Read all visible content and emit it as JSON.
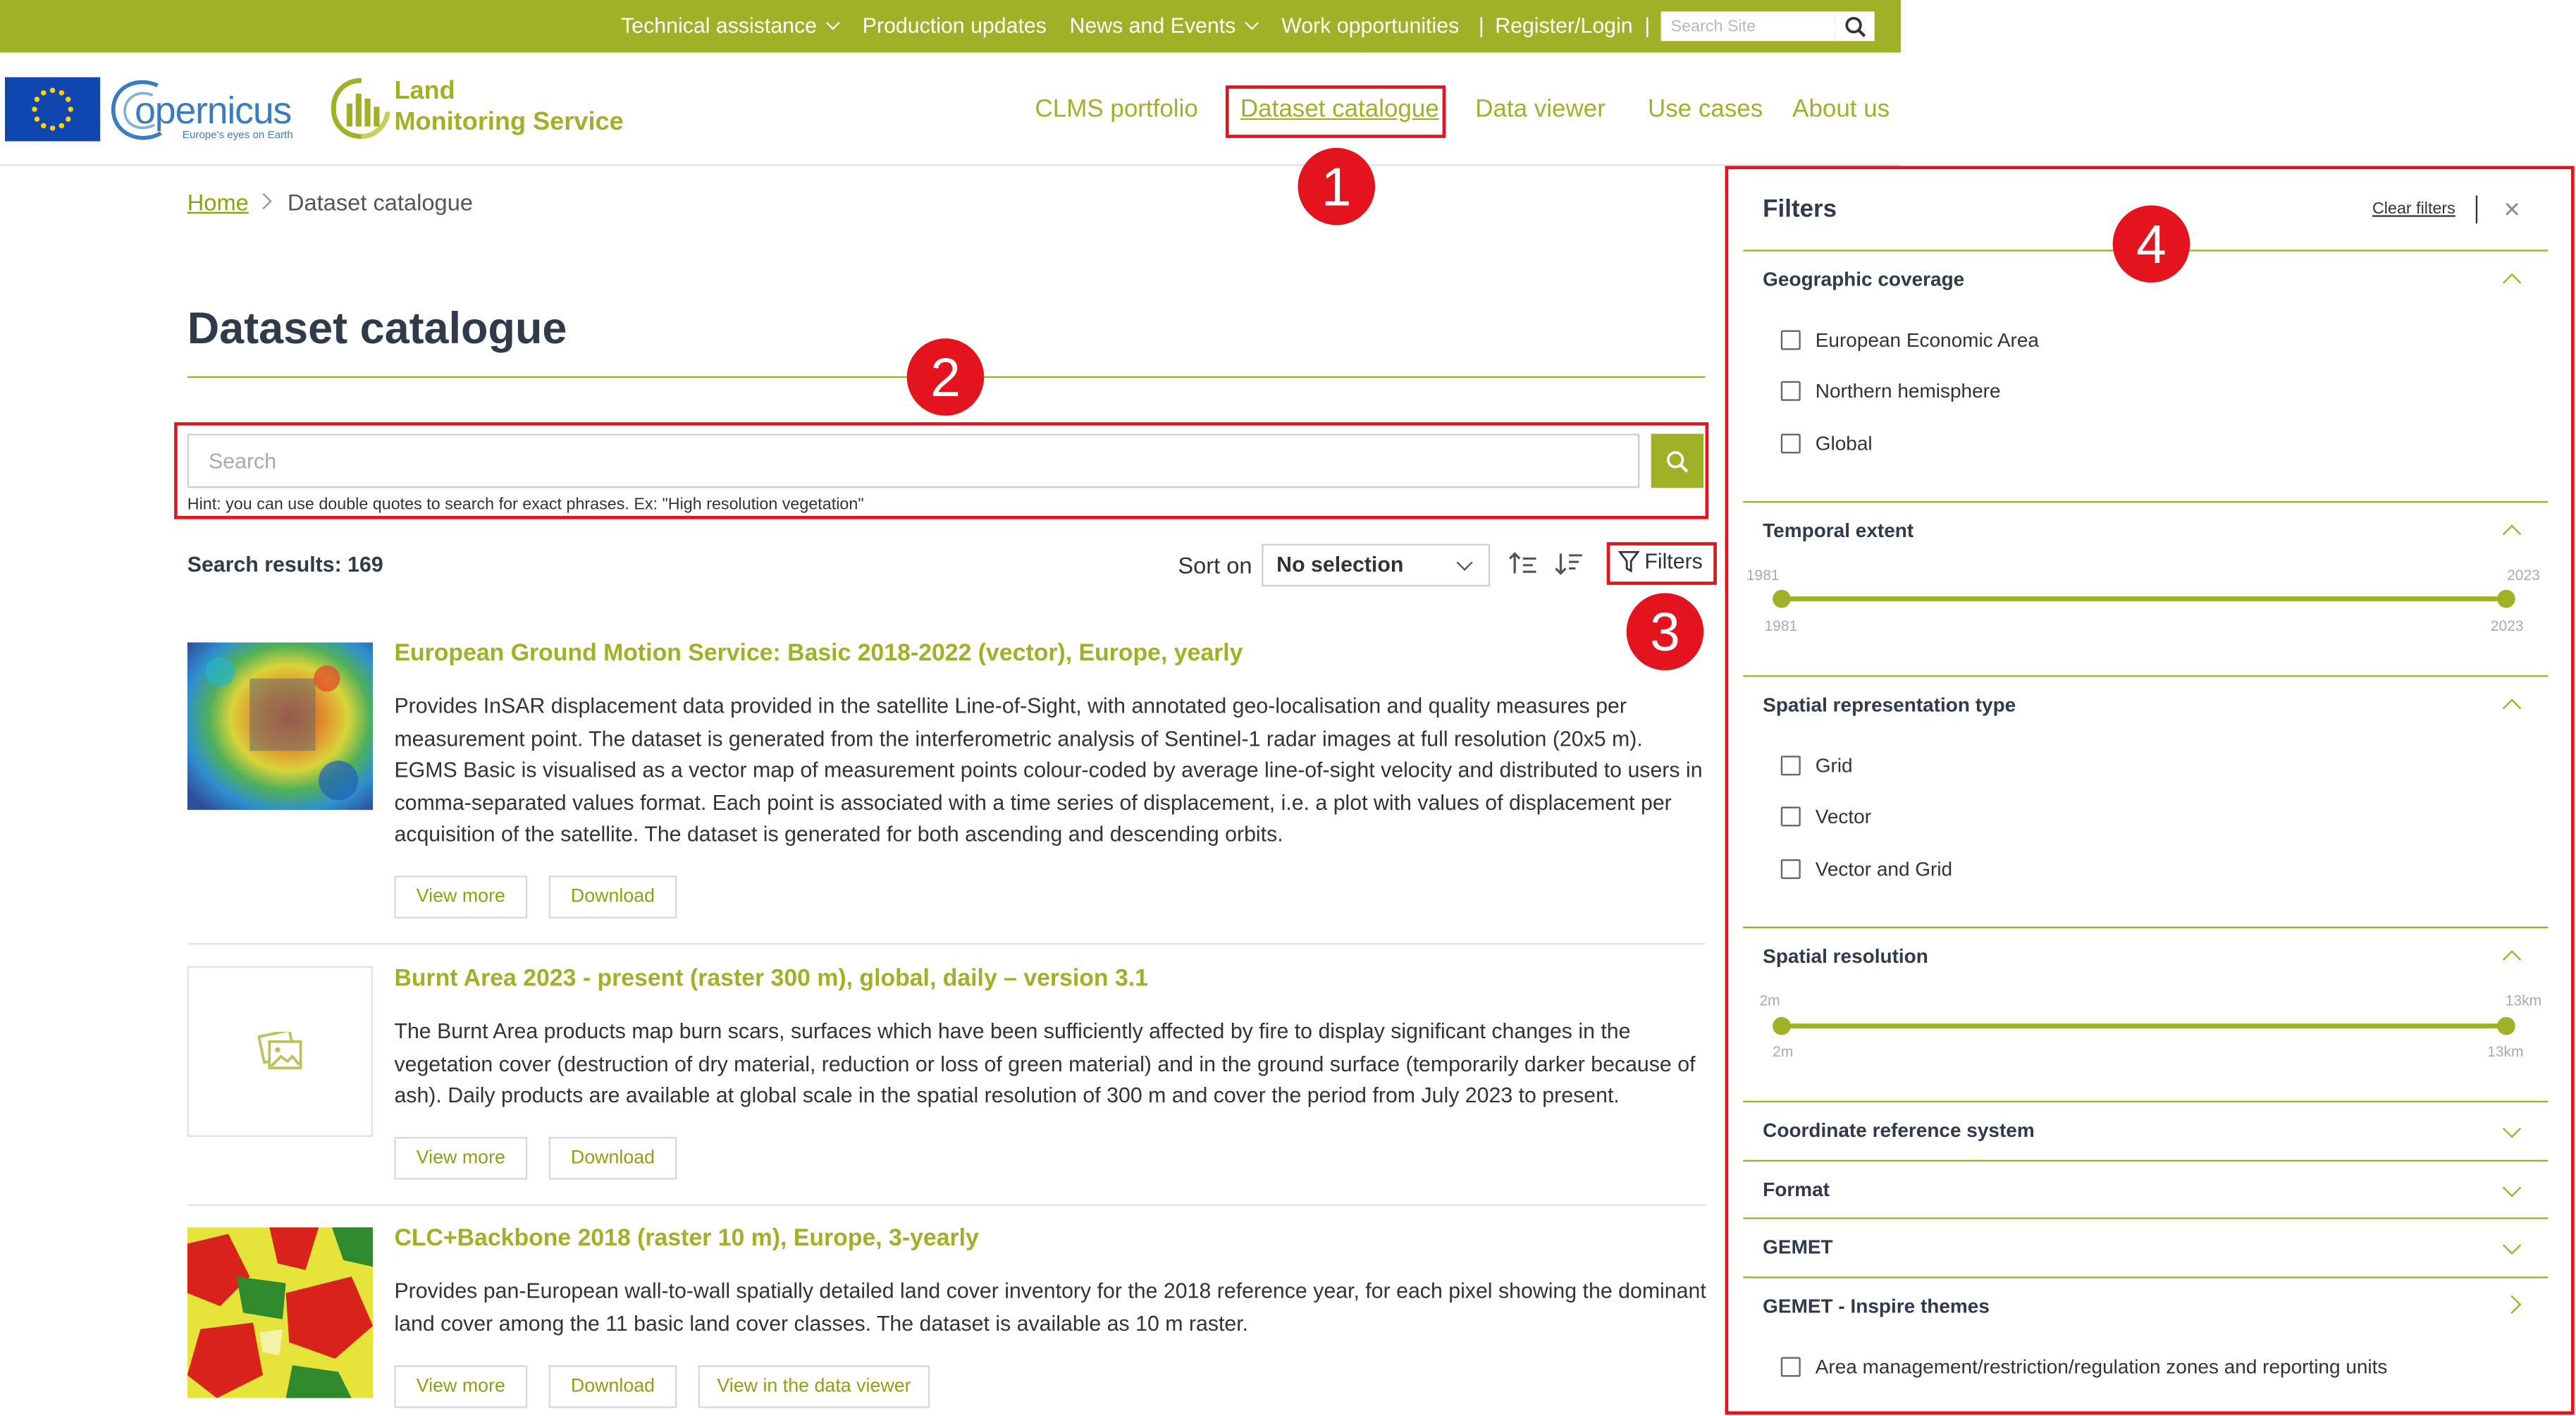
{
  "topbar": {
    "items": [
      {
        "label": "Technical assistance",
        "has_dropdown": true
      },
      {
        "label": "Production updates",
        "has_dropdown": false
      },
      {
        "label": "News and Events",
        "has_dropdown": true
      },
      {
        "label": "Work opportunities",
        "has_dropdown": false
      },
      {
        "label": "Register/Login",
        "has_dropdown": false
      }
    ],
    "separator": "|",
    "search_placeholder": "Search Site"
  },
  "header": {
    "copernicus_logo_text": "opernicus",
    "copernicus_logo_letter": "C",
    "copernicus_tagline": "Europe's eyes on Earth",
    "lms_line1": "Land",
    "lms_line2": "Monitoring Service",
    "nav": [
      "CLMS portfolio",
      "Dataset catalogue",
      "Data viewer",
      "Use cases",
      "About us"
    ],
    "active_nav": "Dataset catalogue"
  },
  "breadcrumb": {
    "home": "Home",
    "current": "Dataset catalogue"
  },
  "page_title": "Dataset catalogue",
  "search": {
    "placeholder": "Search",
    "value": "",
    "hint": "Hint: you can use double quotes to search for exact phrases. Ex: \"High resolution vegetation\""
  },
  "results": {
    "label": "Search results: 169",
    "sort_label": "Sort on",
    "sort_value": "No selection",
    "filters_label": "Filters"
  },
  "datasets": [
    {
      "title": "European Ground Motion Service: Basic 2018-2022 (vector), Europe, yearly",
      "description": "Provides InSAR displacement data provided in the satellite Line-of-Sight, with annotated geo-localisation and quality measures per measurement point. The dataset is generated from the interferometric analysis of Sentinel-1 radar images at full resolution (20x5 m). EGMS Basic is visualised as a vector map of measurement points colour-coded by average line-of-sight velocity and distributed to users in comma-separated values format. Each point is associated with a time series of displacement, i.e. a plot with values of displacement per acquisition of the satellite. The dataset is generated for both ascending and descending orbits.",
      "buttons": [
        "View more",
        "Download"
      ]
    },
    {
      "title": "Burnt Area 2023 - present (raster 300 m), global, daily – version 3.1",
      "description": "The Burnt Area products map burn scars, surfaces which have been sufficiently affected by fire to display significant changes in the vegetation cover (destruction of dry material, reduction or loss of green material) and in the ground surface (temporarily darker because of ash). Daily products are available at global scale in the spatial resolution of 300 m and cover the period from July 2023 to present.",
      "buttons": [
        "View more",
        "Download"
      ]
    },
    {
      "title": "CLC+Backbone 2018 (raster 10 m), Europe, 3-yearly",
      "description": "Provides pan-European wall-to-wall spatially detailed land cover inventory for the 2018 reference year, for each pixel showing the dominant land cover among the 11 basic land cover classes. The dataset is available as 10 m raster.",
      "buttons": [
        "View more",
        "Download",
        "View in the data viewer"
      ]
    }
  ],
  "filters": {
    "title": "Filters",
    "clear": "Clear filters",
    "close": "×",
    "geographic_coverage": {
      "heading": "Geographic coverage",
      "options": [
        "European Economic Area",
        "Northern hemisphere",
        "Global"
      ]
    },
    "temporal_extent": {
      "heading": "Temporal extent",
      "min": "1981",
      "max": "2023",
      "low": "1981",
      "high": "2023"
    },
    "spatial_representation": {
      "heading": "Spatial representation type",
      "options": [
        "Grid",
        "Vector",
        "Vector and Grid"
      ]
    },
    "spatial_resolution": {
      "heading": "Spatial resolution",
      "min": "2m",
      "max": "13km",
      "low": "2m",
      "high": "13km"
    },
    "collapsed": [
      "Coordinate reference system",
      "Format",
      "GEMET"
    ],
    "inspire": {
      "heading": "GEMET - Inspire themes",
      "options": [
        "Area management/restriction/regulation zones and reporting units"
      ]
    }
  },
  "annotations": [
    "1",
    "2",
    "3",
    "4"
  ],
  "colors": {
    "brand": "#a0b128",
    "annotation": "#e3141e",
    "title": "#2f3b4a",
    "eu_blue": "#0f47af"
  },
  "icons": [
    "chevron-down-icon",
    "search-icon",
    "sort-ascending-icon",
    "sort-descending-icon",
    "filter-icon",
    "close-icon",
    "image-placeholder-icon",
    "chevron-up-icon",
    "eu-flag-icon",
    "lms-logo-icon"
  ]
}
